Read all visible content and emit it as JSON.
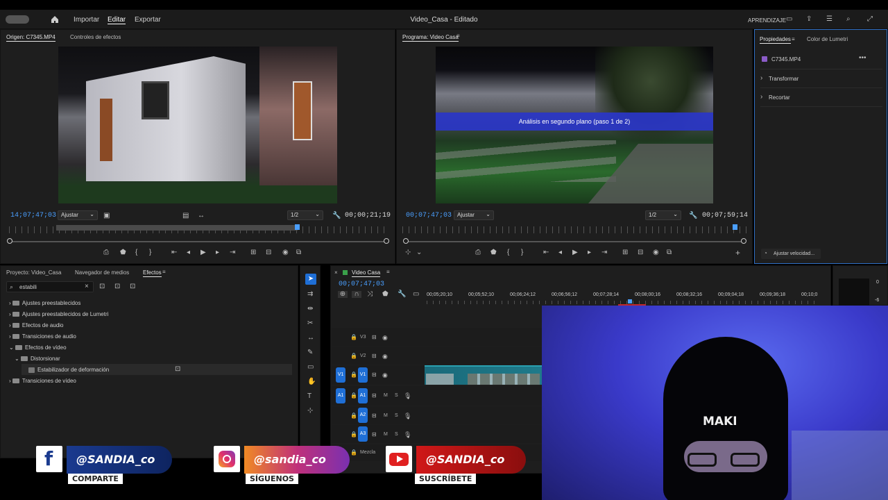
{
  "app": {
    "title": "Video_Casa",
    "status": "Editado",
    "title_sep": "-"
  },
  "nav": {
    "import": "Importar",
    "edit": "Editar",
    "export": "Exportar",
    "learn": "APRENDIZAJE"
  },
  "source": {
    "tab1": "Origen: C7345.MP4",
    "tab2": "Controles de efectos",
    "timecode": "14;07;47;03",
    "fit": "Ajustar",
    "quality": "1/2",
    "duration": "00;00;21;19"
  },
  "program": {
    "tab": "Programa: Video Casa",
    "timecode": "00;07;47;03",
    "fit": "Ajustar",
    "quality": "1/2",
    "duration": "00;07;59;14",
    "overlay": "Análisis en segundo plano (paso 1 de 2)"
  },
  "properties": {
    "tab1": "Propiedades",
    "tab2": "Color de Lumetri",
    "clip": "C7345.MP4",
    "transform": "Transformar",
    "crop": "Recortar",
    "speed": "Ajustar velocidad..."
  },
  "project": {
    "tab1": "Proyecto: Video_Casa",
    "tab2": "Navegador de medios",
    "tab3": "Efectos",
    "search": "estabili",
    "items": [
      "Ajustes preestablecidos",
      "Ajustes preestablecidos de Lumetri",
      "Efectos de audio",
      "Transiciones de audio",
      "Efectos de vídeo",
      "Distorsionar",
      "Estabilizador de deformación",
      "Transiciones de vídeo"
    ]
  },
  "timeline": {
    "tab": "Video Casa",
    "timecode": "00;07;47;03",
    "ruler": [
      "00;05;20;10",
      "00;05;52;10",
      "00;06;24;12",
      "00;06;56;12",
      "00;07;28;14",
      "00;08;00;16",
      "00;08;32;16",
      "00;09;04;18",
      "00;09;36;18",
      "00;10;0"
    ],
    "tracks": {
      "v3": "V3",
      "v2": "V2",
      "v1": "V1",
      "a1": "A1",
      "a2": "A2",
      "a3": "A3",
      "mix": "Mezcla",
      "m": "M",
      "s": "S"
    },
    "meter": [
      "0",
      "-6"
    ]
  },
  "webcam": {
    "cap_text": "MAKI"
  },
  "social": {
    "facebook": {
      "handle": "@SANDIA_co",
      "label": "COMPARTE",
      "icon": "f"
    },
    "instagram": {
      "handle": "@sandia_co",
      "label": "SÍGUENOS"
    },
    "youtube": {
      "handle": "@SANDIA_co",
      "label": "SUSCRÍBETE"
    }
  },
  "colors": {
    "accent": "#1f6fd6",
    "timecode": "#4a9fff",
    "panel": "#1e1e1e"
  }
}
